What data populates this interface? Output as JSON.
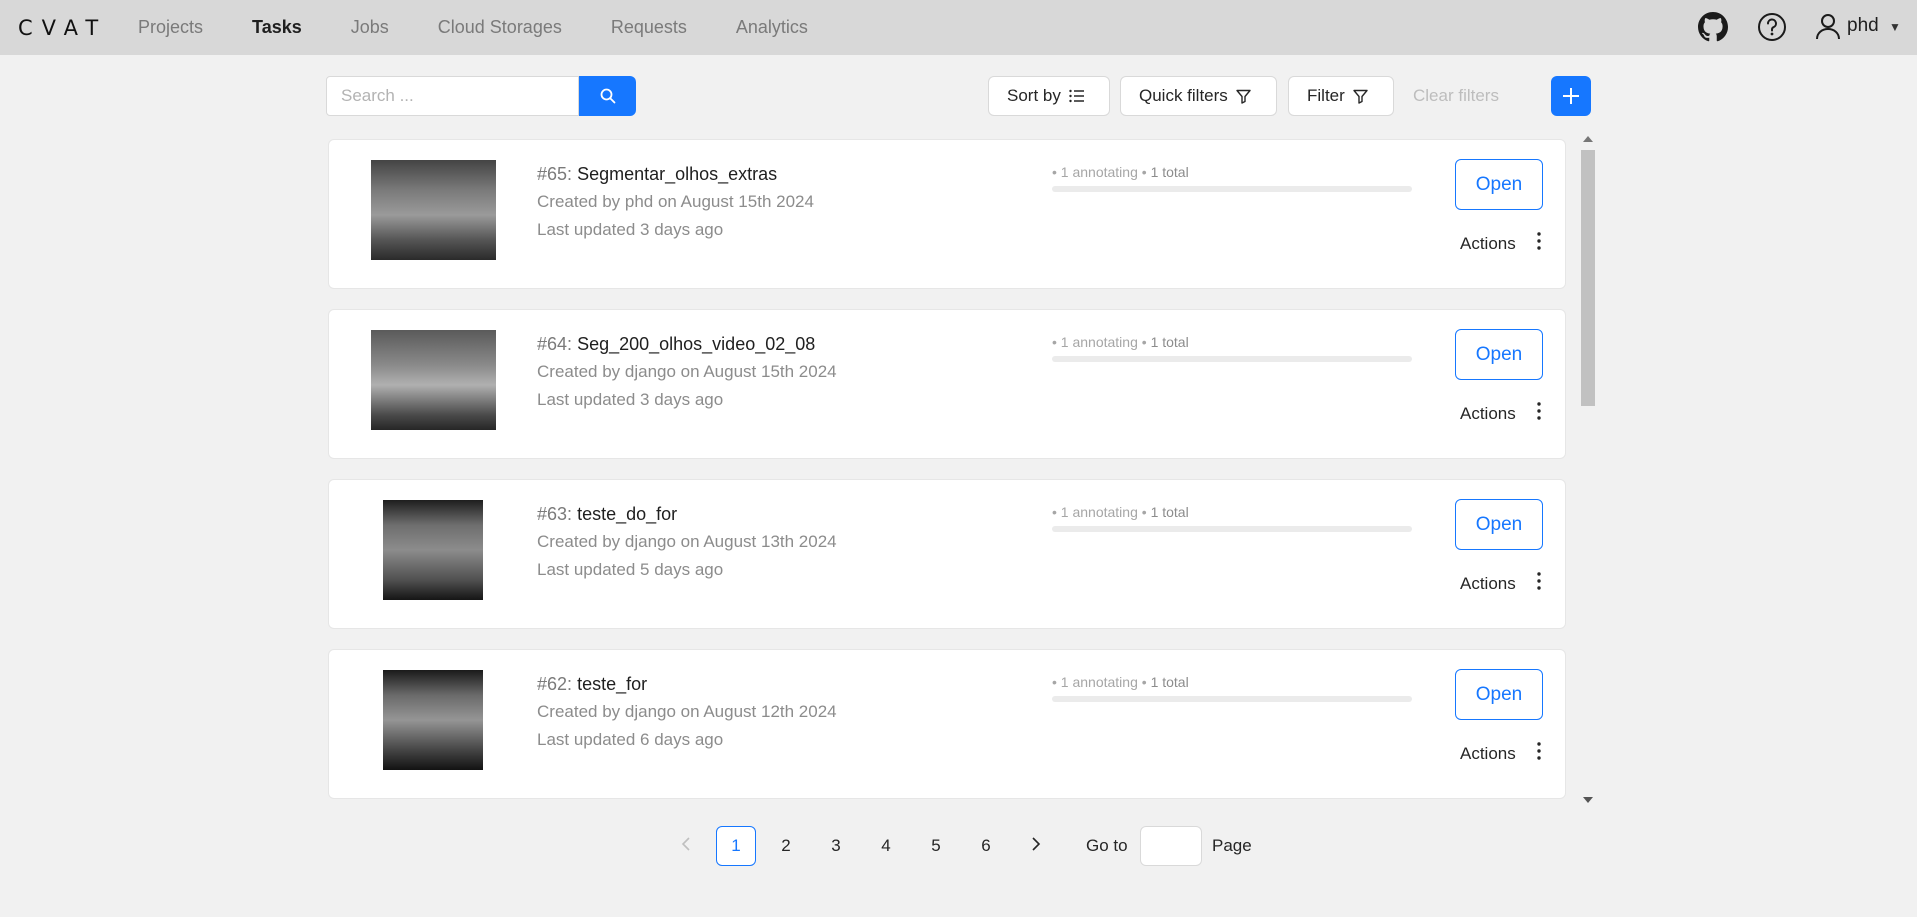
{
  "header": {
    "logo": "CVAT",
    "nav": [
      {
        "label": "Projects",
        "active": false
      },
      {
        "label": "Tasks",
        "active": true
      },
      {
        "label": "Jobs",
        "active": false
      },
      {
        "label": "Cloud Storages",
        "active": false
      },
      {
        "label": "Requests",
        "active": false
      },
      {
        "label": "Analytics",
        "active": false
      }
    ],
    "icons": [
      "github-icon",
      "help-icon",
      "user-icon"
    ],
    "user": "phd"
  },
  "toolbar": {
    "search_placeholder": "Search ...",
    "sort_label": "Sort by",
    "quick_filters_label": "Quick filters",
    "filter_label": "Filter",
    "clear_filters_label": "Clear filters",
    "accent_color": "#1677ff"
  },
  "tasks": [
    {
      "id": "#65",
      "name": "Segmentar_olhos_extras",
      "created": "Created by phd on August 15th 2024",
      "updated": "Last updated 3 days ago",
      "status_annotating": "1 annotating",
      "status_total": "1 total",
      "open_label": "Open",
      "actions_label": "Actions"
    },
    {
      "id": "#64",
      "name": "Seg_200_olhos_video_02_08",
      "created": "Created by django on August 15th 2024",
      "updated": "Last updated 3 days ago",
      "status_annotating": "1 annotating",
      "status_total": "1 total",
      "open_label": "Open",
      "actions_label": "Actions"
    },
    {
      "id": "#63",
      "name": "teste_do_for",
      "created": "Created by django on August 13th 2024",
      "updated": "Last updated 5 days ago",
      "status_annotating": "1 annotating",
      "status_total": "1 total",
      "open_label": "Open",
      "actions_label": "Actions"
    },
    {
      "id": "#62",
      "name": "teste_for",
      "created": "Created by django on August 12th 2024",
      "updated": "Last updated 6 days ago",
      "status_annotating": "1 annotating",
      "status_total": "1 total",
      "open_label": "Open",
      "actions_label": "Actions"
    }
  ],
  "pagination": {
    "pages": [
      "1",
      "2",
      "3",
      "4",
      "5",
      "6"
    ],
    "current": "1",
    "goto_label": "Go to",
    "page_label": "Page"
  }
}
